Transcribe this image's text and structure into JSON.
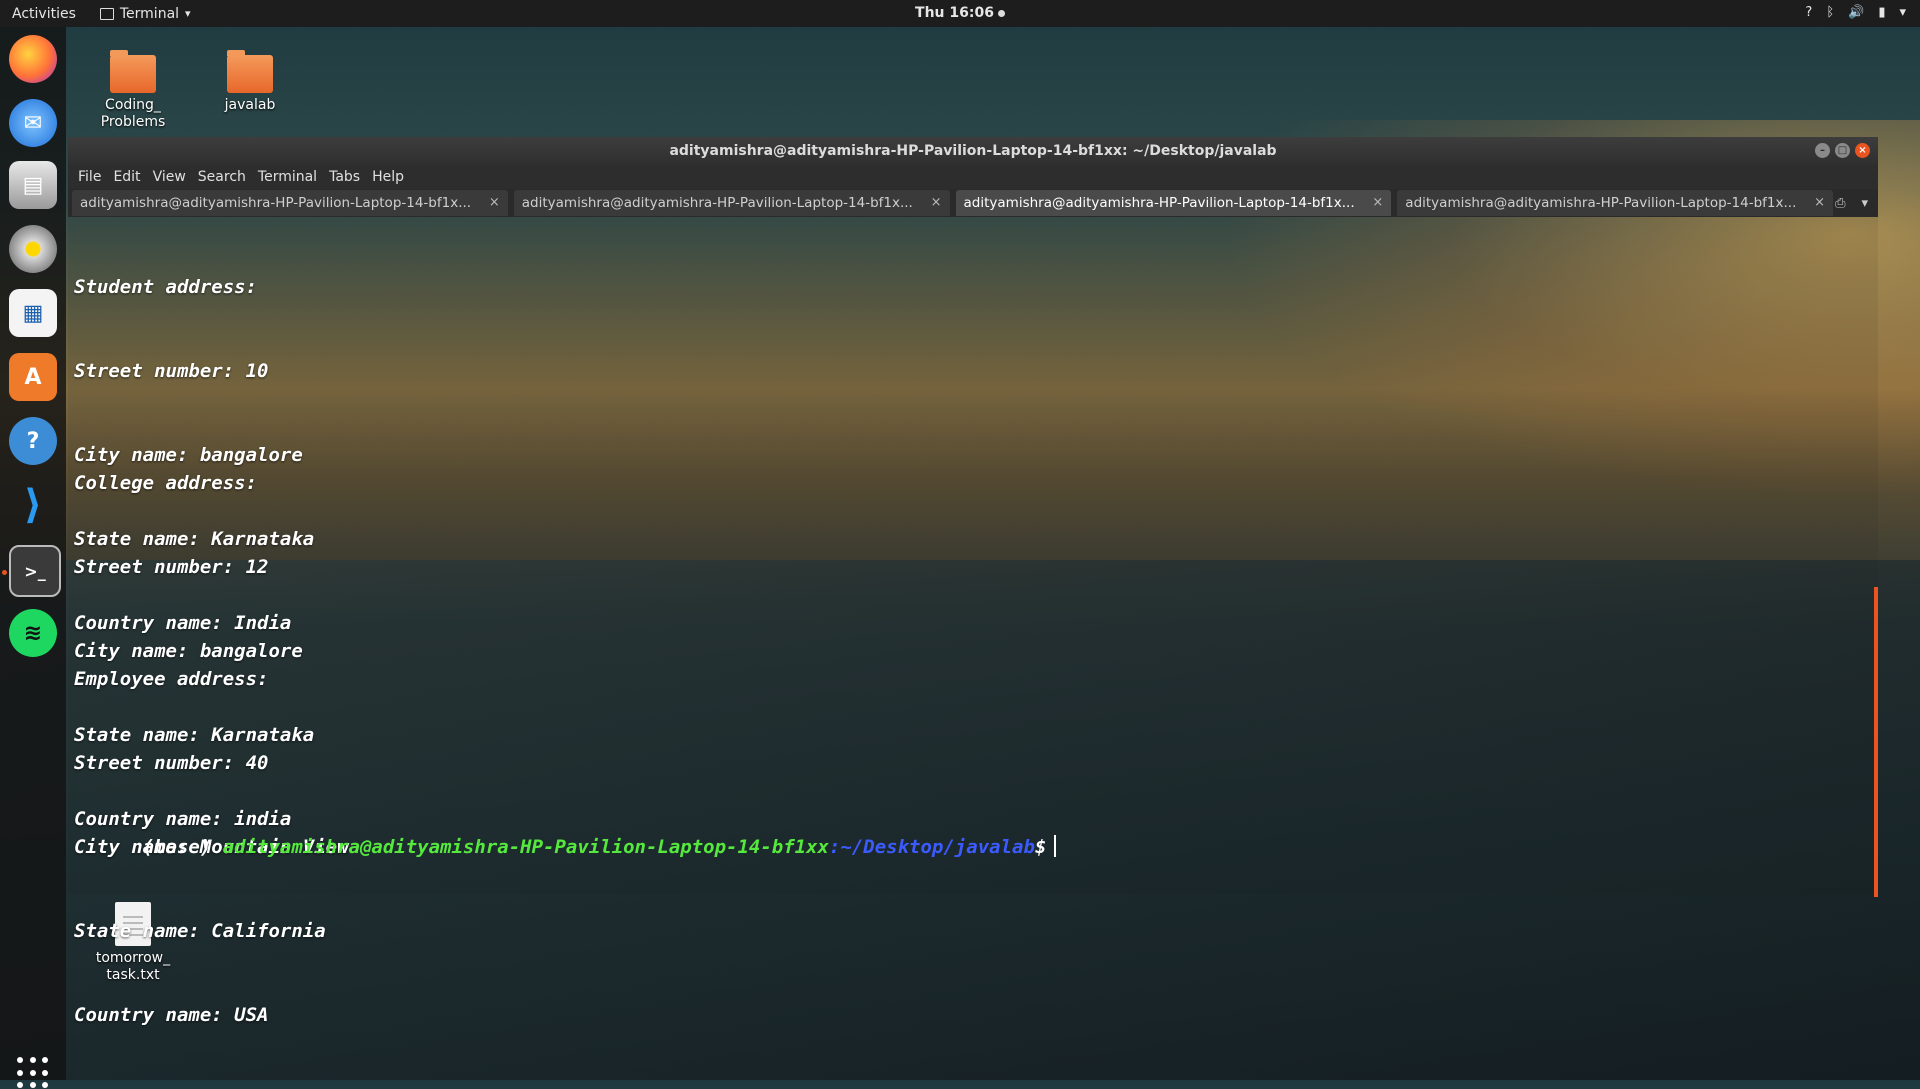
{
  "topbar": {
    "activities": "Activities",
    "app_name": "Terminal",
    "app_menu_arrow": "▾",
    "clock": "Thu 16:06",
    "status_icons": [
      "help-icon",
      "bluetooth-icon",
      "volume-icon",
      "battery-icon",
      "system-menu-icon"
    ],
    "status_glyphs": [
      "?",
      "ᛒ",
      "🔊",
      "▮",
      "▾"
    ]
  },
  "dock": {
    "apps": [
      "Firefox",
      "Thunderbird",
      "Files",
      "Rhythmbox",
      "LibreOffice Writer",
      "Ubuntu Software",
      "Help",
      "Visual Studio Code",
      "Terminal",
      "Spotify"
    ]
  },
  "desktop": {
    "icons": [
      {
        "label": "Coding_\nProblems",
        "type": "folder"
      },
      {
        "label": "javalab",
        "type": "folder"
      },
      {
        "label": "tomorrow_\ntask.txt",
        "type": "file"
      }
    ]
  },
  "window": {
    "title": "adityamishra@adityamishra-HP-Pavilion-Laptop-14-bf1xx: ~/Desktop/javalab",
    "minimize": "–",
    "maximize": "□",
    "close": "×"
  },
  "menubar": [
    "File",
    "Edit",
    "View",
    "Search",
    "Terminal",
    "Tabs",
    "Help"
  ],
  "tabs": [
    {
      "label": "adityamishra@adityamishra-HP-Pavilion-Laptop-14-bf1x...",
      "active": false
    },
    {
      "label": "adityamishra@adityamishra-HP-Pavilion-Laptop-14-bf1x...",
      "active": false
    },
    {
      "label": "adityamishra@adityamishra-HP-Pavilion-Laptop-14-bf1x...",
      "active": true
    },
    {
      "label": "adityamishra@adityamishra-HP-Pavilion-Laptop-14-bf1x...",
      "active": false
    }
  ],
  "tab_close": "×",
  "tab_tools": {
    "new_tab": "⎙",
    "tab_menu": "▾"
  },
  "output": {
    "student": [
      "Student address:",
      "Street number: 10",
      "City name: bangalore",
      "State name: Karnataka",
      "Country name: India"
    ],
    "college": [
      "College address:",
      "Street number: 12",
      "City name: bangalore",
      "State name: Karnataka",
      "Country name: india"
    ],
    "employee": [
      "Employee address:",
      "Street number: 40",
      "City name: Mountain View",
      "State name: California",
      "Country name: USA"
    ]
  },
  "prompt": {
    "env": "(base) ",
    "user_host": "adityamishra@adityamishra-HP-Pavilion-Laptop-14-bf1xx",
    "path": ":~/Desktop/javalab",
    "symbol": "$"
  },
  "colors": {
    "accent": "#e95420",
    "prompt_user": "#55e83d",
    "prompt_path": "#3b5bff"
  }
}
